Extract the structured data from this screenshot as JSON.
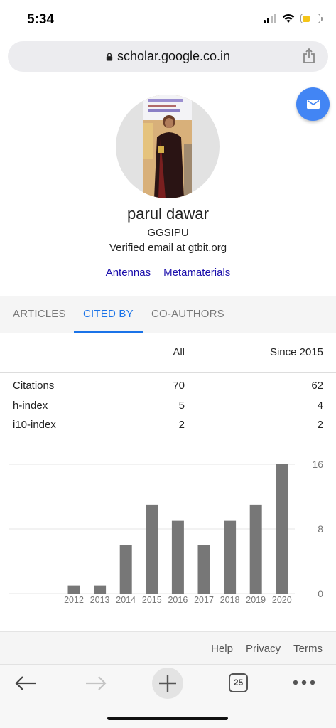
{
  "status_bar": {
    "time": "5:34"
  },
  "browser": {
    "url": "scholar.google.co.in",
    "tab_count": "25"
  },
  "profile": {
    "name": "parul dawar",
    "affiliation": "GGSIPU",
    "email": "Verified email at gtbit.org",
    "interests": [
      "Antennas",
      "Metamaterials"
    ]
  },
  "tabs": [
    {
      "label": "ARTICLES",
      "active": false
    },
    {
      "label": "CITED BY",
      "active": true
    },
    {
      "label": "CO-AUTHORS",
      "active": false
    }
  ],
  "stats": {
    "headers": {
      "all": "All",
      "since": "Since 2015"
    },
    "rows": [
      {
        "label": "Citations",
        "all": "70",
        "since": "62"
      },
      {
        "label": "h-index",
        "all": "5",
        "since": "4"
      },
      {
        "label": "i10-index",
        "all": "2",
        "since": "2"
      }
    ]
  },
  "chart_data": {
    "type": "bar",
    "categories": [
      "2012",
      "2013",
      "2014",
      "2015",
      "2016",
      "2017",
      "2018",
      "2019",
      "2020"
    ],
    "values": [
      1,
      1,
      6,
      11,
      9,
      6,
      9,
      11,
      16
    ],
    "ylim": [
      0,
      16
    ],
    "yticks": [
      "16",
      "8",
      "0"
    ],
    "grid": true,
    "bar_color": "#777777"
  },
  "footer": {
    "links": [
      "Help",
      "Privacy",
      "Terms"
    ]
  },
  "colors": {
    "accent": "#1a73e8",
    "link": "#1a0dab",
    "fab": "#4285f4"
  }
}
